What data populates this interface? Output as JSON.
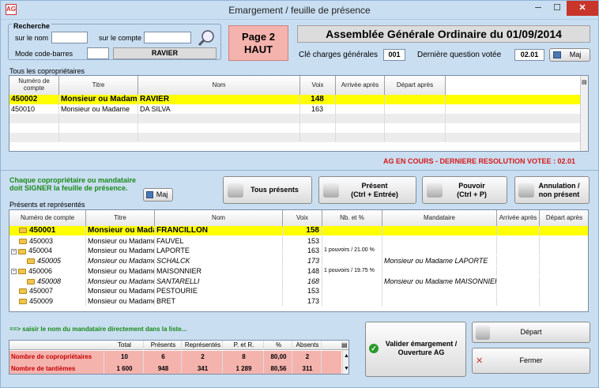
{
  "window": {
    "title": "Emargement / feuille de présence",
    "icon": "app-icon",
    "min": "─",
    "max": "☐",
    "close": "✕"
  },
  "search": {
    "legend": "Recherche",
    "name_label": "sur le nom",
    "account_label": "sur le compte",
    "barcode_label": "Mode code-barres",
    "name_value": "",
    "account_value": "",
    "barcode_value": "",
    "current_name": "RAVIER"
  },
  "page_badge": {
    "line1": "Page 2",
    "line2": "HAUT"
  },
  "meeting": {
    "title": "Assemblée Générale Ordinaire du 01/09/2014",
    "key_label": "Clé charges générales",
    "key_value": "001",
    "last_q_label": "Dernière question votée",
    "last_q_value": "02.01",
    "maj": "Maj"
  },
  "owners": {
    "section_label": "Tous les copropriétaires",
    "columns": [
      "Numéro de compte",
      "Titre",
      "Nom",
      "Voix",
      "Arrivée après",
      "Départ après"
    ],
    "rows": [
      {
        "account": "450002",
        "title": "Monsieur ou Madame",
        "name": "RAVIER",
        "votes": "148",
        "arrival": "",
        "departure": ""
      },
      {
        "account": "450010",
        "title": "Monsieur ou Madame",
        "name": "DA SILVA",
        "votes": "163",
        "arrival": "",
        "departure": ""
      }
    ]
  },
  "status_text": "AG EN COURS - DERNIERE RESOLUTION VOTEE : 02.01",
  "instructions": {
    "line1": "Chaque copropriétaire ou mandataire",
    "line2": "doit SIGNER la feuille de présence.",
    "maj": "Maj"
  },
  "actions": {
    "all_present": "Tous présents",
    "present1": "Présent",
    "present2": "(Ctrl + Entrée)",
    "power1": "Pouvoir",
    "power2": "(Ctrl + P)",
    "cancel1": "Annulation /",
    "cancel2": "non présent"
  },
  "present": {
    "section_label": "Présents et représentés",
    "columns": [
      "Numéro de compte",
      "Titre",
      "Nom",
      "Voix",
      "Nb. et %",
      "Mandataire",
      "Arrivée après",
      "Départ après"
    ],
    "rows": [
      {
        "level": 0,
        "exp": "",
        "account": "450001",
        "title": "Monsieur ou Madame",
        "name": "FRANCILLON",
        "votes": "158",
        "nb": "",
        "proxy": "",
        "highlight": true,
        "italic": false
      },
      {
        "level": 0,
        "exp": "",
        "account": "450003",
        "title": "Monsieur ou Madame",
        "name": "FAUVEL",
        "votes": "153",
        "nb": "",
        "proxy": "",
        "highlight": false,
        "italic": false
      },
      {
        "level": 0,
        "exp": "−",
        "account": "450004",
        "title": "Monsieur ou Madame",
        "name": "LAPORTE",
        "votes": "163",
        "nb": "1 pouvoirs / 21.00 %",
        "proxy": "",
        "highlight": false,
        "italic": false
      },
      {
        "level": 1,
        "exp": "",
        "account": "450005",
        "title": "Monsieur ou Madame",
        "name": "SCHALCK",
        "votes": "173",
        "nb": "",
        "proxy": "Monsieur ou Madame LAPORTE",
        "highlight": false,
        "italic": true
      },
      {
        "level": 0,
        "exp": "−",
        "account": "450006",
        "title": "Monsieur ou Madame",
        "name": "MAISONNIER",
        "votes": "148",
        "nb": "1 pouvoirs / 19.75 %",
        "proxy": "",
        "highlight": false,
        "italic": false
      },
      {
        "level": 1,
        "exp": "",
        "account": "450008",
        "title": "Monsieur ou Madame",
        "name": "SANTARELLI",
        "votes": "168",
        "nb": "",
        "proxy": "Monsieur ou Madame MAISONNIER",
        "highlight": false,
        "italic": true
      },
      {
        "level": 0,
        "exp": "",
        "account": "450007",
        "title": "Monsieur ou Madame",
        "name": "PESTOURIE",
        "votes": "153",
        "nb": "",
        "proxy": "",
        "highlight": false,
        "italic": false
      },
      {
        "level": 0,
        "exp": "",
        "account": "450009",
        "title": "Monsieur ou Madame",
        "name": "BRET",
        "votes": "173",
        "nb": "",
        "proxy": "",
        "highlight": false,
        "italic": false
      }
    ]
  },
  "hint": "==> saisir le nom du mandataire directement dans la liste...",
  "totals": {
    "columns": [
      "Total",
      "Présents",
      "Représentés",
      "P. et R.",
      "%",
      "Absents"
    ],
    "rows": [
      {
        "label": "Nombre de copropriétaires",
        "values": [
          "10",
          "6",
          "2",
          "8",
          "80,00",
          "2"
        ]
      },
      {
        "label": "Nombre de tantièmes",
        "values": [
          "1 600",
          "948",
          "341",
          "1 289",
          "80,56",
          "311"
        ]
      }
    ]
  },
  "validate": {
    "line1": "Valider émargement /",
    "line2": "Ouverture AG"
  },
  "buttons": {
    "depart": "Départ",
    "close": "Fermer"
  },
  "colors": {
    "highlight": "#ffff00",
    "pink": "#f5b3ae",
    "red_text": "#d81818",
    "green_text": "#1a8a1a",
    "totals_red": "#c40000"
  }
}
